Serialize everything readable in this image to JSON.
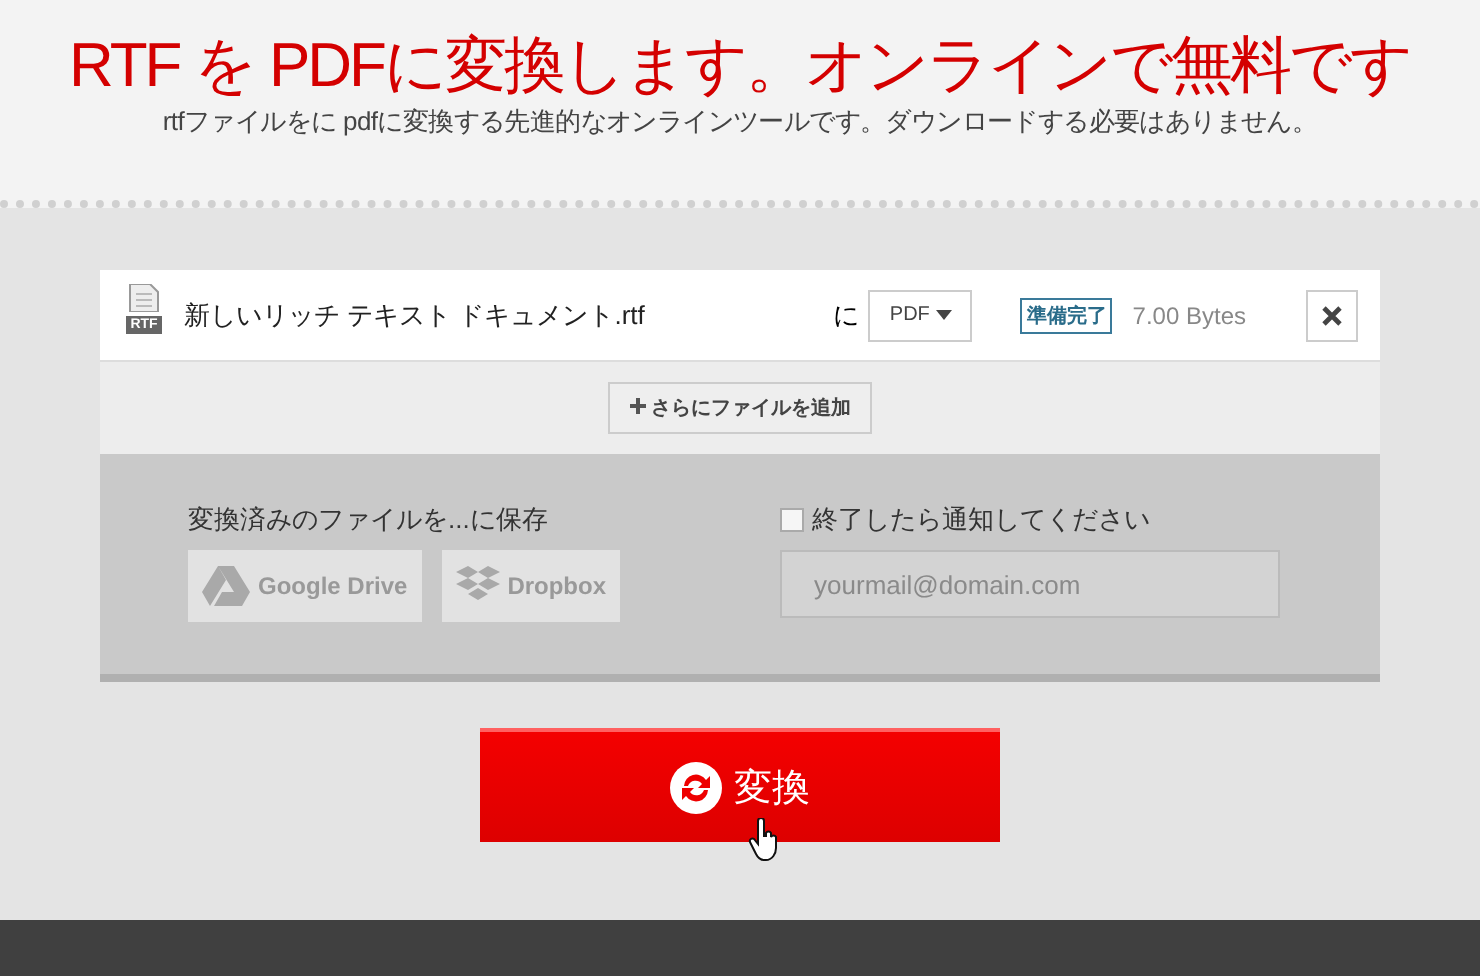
{
  "header": {
    "title": "RTF を PDFに変換します。オンラインで無料です",
    "subtitle": "rtfファイルをに pdfに変換する先進的なオンラインツールです。ダウンロードする必要はありません。"
  },
  "file": {
    "name": "新しいリッチ テキスト ドキュメント.rtf",
    "icon_label": "RTF",
    "to_label": "に",
    "format": "PDF",
    "status": "準備完了",
    "size": "7.00 Bytes"
  },
  "add_button": "さらにファイルを追加",
  "save": {
    "label": "変換済みのファイルを...に保存",
    "services": [
      {
        "kind": "drive",
        "label": "Google Drive"
      },
      {
        "kind": "dropbox",
        "label": "Dropbox"
      }
    ]
  },
  "notify": {
    "label": "終了したら通知してください",
    "checked": false,
    "placeholder": "yourmail@domain.com"
  },
  "convert_button": "変換"
}
